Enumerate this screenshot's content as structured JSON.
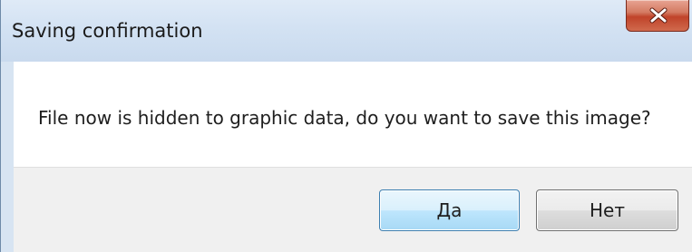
{
  "dialog": {
    "title": "Saving confirmation",
    "message": "File now is hidden to graphic data, do you want to save this image?",
    "close_icon": "close-icon",
    "buttons": {
      "yes_label": "Да",
      "no_label": "Нет"
    }
  },
  "colors": {
    "frame": "#d7e4f2",
    "close_button": "#c0432a",
    "default_button_border": "#3c7fb1",
    "footer": "#f0f0f0"
  }
}
